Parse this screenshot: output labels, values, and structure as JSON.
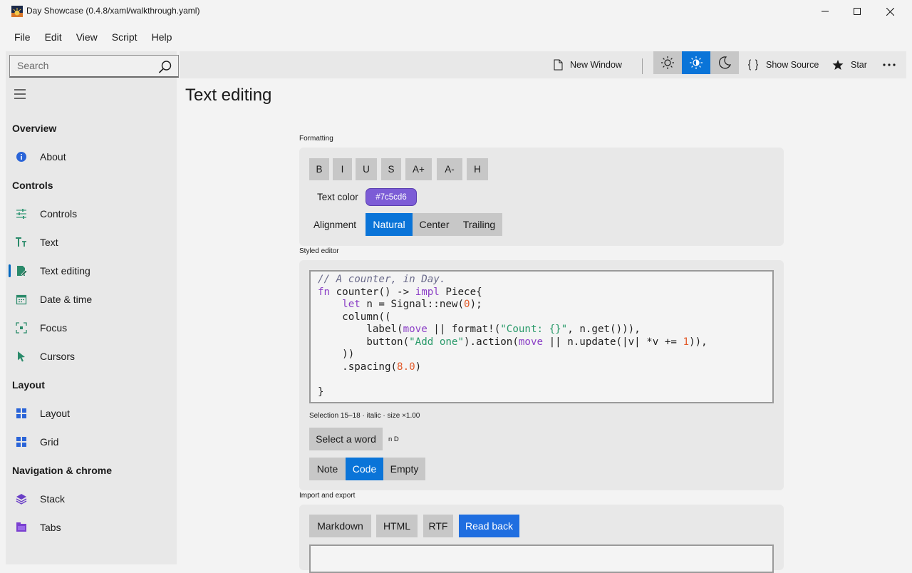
{
  "window": {
    "title": "Day Showcase (0.4.8/xaml/walkthrough.yaml)"
  },
  "menu": [
    "File",
    "Edit",
    "View",
    "Script",
    "Help"
  ],
  "search": {
    "placeholder": "Search"
  },
  "sidebar": {
    "sections": [
      {
        "title": "Overview",
        "items": [
          {
            "label": "About",
            "icon": "info-icon"
          }
        ]
      },
      {
        "title": "Controls",
        "items": [
          {
            "label": "Controls",
            "icon": "sliders-icon"
          },
          {
            "label": "Text",
            "icon": "text-size-icon"
          },
          {
            "label": "Text editing",
            "icon": "text-edit-icon",
            "selected": true
          },
          {
            "label": "Date & time",
            "icon": "calendar-icon"
          },
          {
            "label": "Focus",
            "icon": "focus-icon"
          },
          {
            "label": "Cursors",
            "icon": "cursor-icon"
          }
        ]
      },
      {
        "title": "Layout",
        "items": [
          {
            "label": "Layout",
            "icon": "layout-icon"
          },
          {
            "label": "Grid",
            "icon": "grid-icon"
          }
        ]
      },
      {
        "title": "Navigation & chrome",
        "items": [
          {
            "label": "Stack",
            "icon": "stack-icon"
          },
          {
            "label": "Tabs",
            "icon": "tabs-icon"
          }
        ]
      }
    ]
  },
  "toolbar": {
    "new_window": "New Window",
    "show_source": "Show Source",
    "star": "Star",
    "theme_active": "system"
  },
  "page": {
    "title": "Text editing",
    "formatting": {
      "label": "Formatting",
      "buttons": [
        "B",
        "I",
        "U",
        "S",
        "A+",
        "A-",
        "H"
      ],
      "text_color_label": "Text color",
      "text_color_value": "#7c5cd6",
      "alignment_label": "Alignment",
      "alignment_options": [
        "Natural",
        "Center",
        "Trailing"
      ],
      "alignment_selected": "Natural"
    },
    "styled_editor": {
      "label": "Styled editor",
      "code_lines": [
        "// A counter, in Day.",
        "fn counter() -> impl Piece{",
        "    let n = Signal::new(0);",
        "    column((",
        "        label(move || format!(\"Count: {}\", n.get())),",
        "        button(\"Add one\").action(move || n.update(|v| *v += 1)),",
        "    ))",
        "    .spacing(8.0)",
        "",
        "}"
      ],
      "selection_info": "Selection 15–18 · italic · size ×1.00",
      "select_word_label": "Select a word",
      "selection_text": "n D",
      "modes": [
        "Note",
        "Code",
        "Empty"
      ],
      "mode_selected": "Code"
    },
    "import_export": {
      "label": "Import and export",
      "buttons": [
        "Markdown",
        "HTML",
        "RTF",
        "Read back"
      ],
      "primary": "Read back"
    }
  }
}
